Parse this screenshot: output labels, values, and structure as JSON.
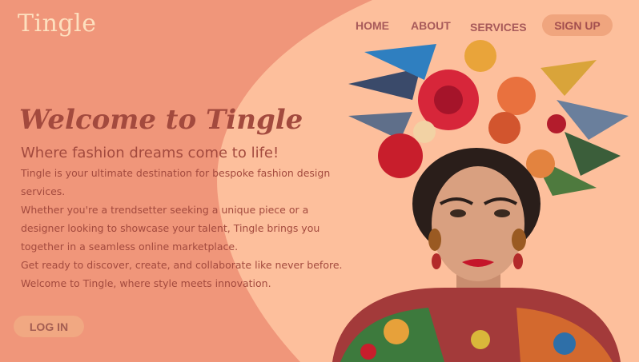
{
  "brand": {
    "logo_text": "Tingle"
  },
  "nav": {
    "home": "HOME",
    "about": "ABOUT",
    "services": "SERVICES",
    "signup": "SIGN UP"
  },
  "hero": {
    "title": "Welcome to Tingle",
    "subtitle": "Where fashion dreams come to life!",
    "paragraphs": [
      "Tingle is your ultimate destination for bespoke fashion design services.",
      "Whether you're a trendsetter seeking a unique piece or a designer looking to showcase your talent, Tingle brings you together in a seamless online marketplace.",
      "Get ready to discover, create, and collaborate like never before.",
      "Welcome to Tingle, where style meets innovation."
    ],
    "login": "LOG IN"
  },
  "colors": {
    "background": "#f0967a",
    "blob": "#fdbf9c",
    "text": "#a34a3e",
    "logo": "#fde0bf",
    "button": "#f0a57e"
  },
  "image": {
    "subject": "portrait-with-flower-crown"
  }
}
